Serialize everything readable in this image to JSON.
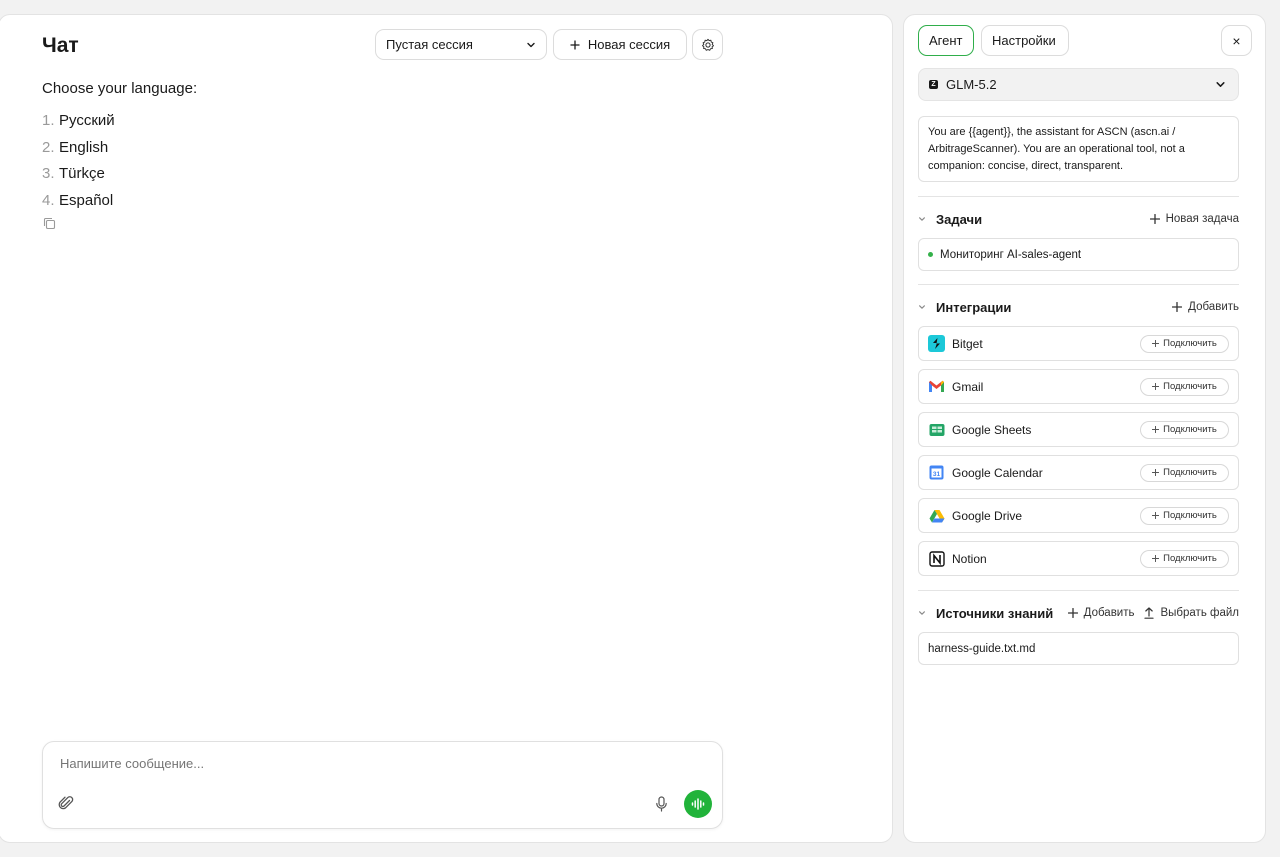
{
  "chat": {
    "title": "Чат",
    "session_select": "Пустая сессия",
    "new_session_label": "Новая сессия",
    "message_heading": "Choose your language:",
    "languages": [
      {
        "num": "1.",
        "label": "Русский"
      },
      {
        "num": "2.",
        "label": "English"
      },
      {
        "num": "3.",
        "label": "Türkçe"
      },
      {
        "num": "4.",
        "label": "Español"
      }
    ],
    "input_placeholder": "Напишите сообщение..."
  },
  "agent": {
    "tabs": [
      {
        "label": "Агент",
        "active": true
      },
      {
        "label": "Настройки",
        "active": false
      }
    ],
    "close_label": "×",
    "model": "GLM-5.2",
    "system_prompt": "You are {{agent}}, the assistant for ASCN (ascn.ai / ArbitrageScanner). You are an operational tool, not a companion: concise, direct, transparent.",
    "tasks": {
      "title": "Задачи",
      "action": "Новая задача",
      "items": [
        "Мониторинг AI-sales-agent"
      ]
    },
    "integrations": {
      "title": "Интеграции",
      "action": "Добавить",
      "connect_label": "Подключить",
      "items": [
        {
          "name": "Bitget",
          "icon": "bitget-icon"
        },
        {
          "name": "Gmail",
          "icon": "gmail-icon"
        },
        {
          "name": "Google Sheets",
          "icon": "google-sheets-icon"
        },
        {
          "name": "Google Calendar",
          "icon": "google-calendar-icon"
        },
        {
          "name": "Google Drive",
          "icon": "google-drive-icon"
        },
        {
          "name": "Notion",
          "icon": "notion-icon"
        }
      ]
    },
    "knowledge": {
      "title": "Источники знаний",
      "add_label": "Добавить",
      "upload_label": "Выбрать файл",
      "items": [
        "harness-guide.txt.md"
      ]
    }
  },
  "colors": {
    "accent_green": "#21b33a",
    "tab_active_border": "#2fae4a"
  }
}
